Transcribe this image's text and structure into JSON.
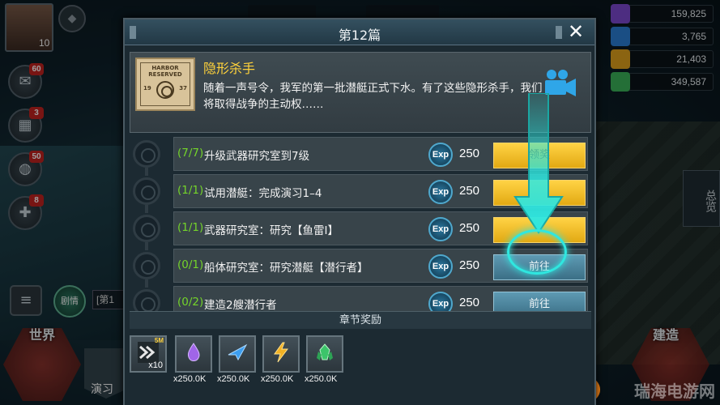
{
  "hud": {
    "player_level": "10",
    "resources": [
      {
        "icon": "purple-drop-icon",
        "value": "159,825"
      },
      {
        "icon": "blue-plane-icon",
        "value": "3,765"
      },
      {
        "icon": "lightning-icon",
        "value": "21,403"
      },
      {
        "icon": "green-crystal-icon",
        "value": "349,587"
      }
    ],
    "side_badges": [
      "60",
      "3",
      "50",
      "8"
    ],
    "world_label": "世界",
    "build_label": "建造",
    "story_label": "剧情",
    "story_chip": "[第1",
    "exercise_label": "演习",
    "overview_label": "总览",
    "watermark": "瑞海电游网"
  },
  "modal": {
    "title": "第12篇",
    "intro": {
      "image_text_line1": "HARBOR",
      "image_text_line2": "RESERVED",
      "image_year_left": "19",
      "image_year_right": "37",
      "title": "隐形杀手",
      "description": "随着一声号令，我军的第一批潜艇正式下水。有了这些隐形杀手，我们将取得战争的主动权……"
    },
    "tasks": [
      {
        "progress": "(7/7)",
        "name": "升级武器研究室到7级",
        "exp_label": "Exp",
        "exp": "250",
        "button": "领奖",
        "state": "claim"
      },
      {
        "progress": "(1/1)",
        "name": "试用潜艇：完成演习1–4",
        "exp_label": "Exp",
        "exp": "250",
        "button": "",
        "state": "claim"
      },
      {
        "progress": "(1/1)",
        "name": "武器研究室：研究【鱼雷I】",
        "exp_label": "Exp",
        "exp": "250",
        "button": "",
        "state": "claim"
      },
      {
        "progress": "(0/1)",
        "name": "船体研究室：研究潜艇【潜行者】",
        "exp_label": "Exp",
        "exp": "250",
        "button": "前往",
        "state": "go"
      },
      {
        "progress": "(0/2)",
        "name": "建造2艘潜行者",
        "exp_label": "Exp",
        "exp": "250",
        "button": "前往",
        "state": "go"
      }
    ],
    "rewards_title": "章节奖励",
    "rewards": [
      {
        "icon": "rank-chevron-icon",
        "corner": "5M",
        "qty": "x10"
      },
      {
        "icon": "purple-drop-icon",
        "qty": "x250.0K"
      },
      {
        "icon": "blue-plane-icon",
        "qty": "x250.0K"
      },
      {
        "icon": "lightning-icon",
        "qty": "x250.0K"
      },
      {
        "icon": "green-crystal-icon",
        "qty": "x250.0K"
      }
    ]
  },
  "colors": {
    "progress_green": "#74d42a",
    "title_gold": "#ffd23b",
    "claim_yellow": "#ffd345",
    "go_blue": "#4d87a0",
    "guide_cyan": "#2fe7e0"
  }
}
